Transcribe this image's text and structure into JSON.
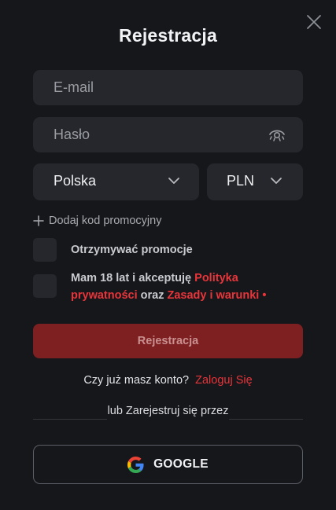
{
  "modal": {
    "title": "Rejestracja",
    "close_icon": "close-icon"
  },
  "form": {
    "email_placeholder": "E-mail",
    "password_placeholder": "Hasło",
    "password_toggle_icon": "eye-icon",
    "country_value": "Polska",
    "currency_value": "PLN",
    "promo_label": "Dodaj kod promocyjny",
    "checkbox_promotions": "Otrzymywać promocje",
    "terms": {
      "prefix": "Mam 18 lat i akceptuję ",
      "privacy_link": "Polityka prywatności",
      "middle": " oraz ",
      "terms_link": "Zasady i warunki",
      "required_mark": " •"
    },
    "submit_label": "Rejestracja"
  },
  "login": {
    "question": "Czy już masz konto?",
    "link": "Zaloguj Się"
  },
  "social": {
    "divider_text": "lub Zarejestruj się przez",
    "google_label": "GOOGLE"
  },
  "colors": {
    "background": "#16171b",
    "field": "#25272c",
    "accent_red": "#e8353a",
    "submit_bg": "#7e2022"
  }
}
